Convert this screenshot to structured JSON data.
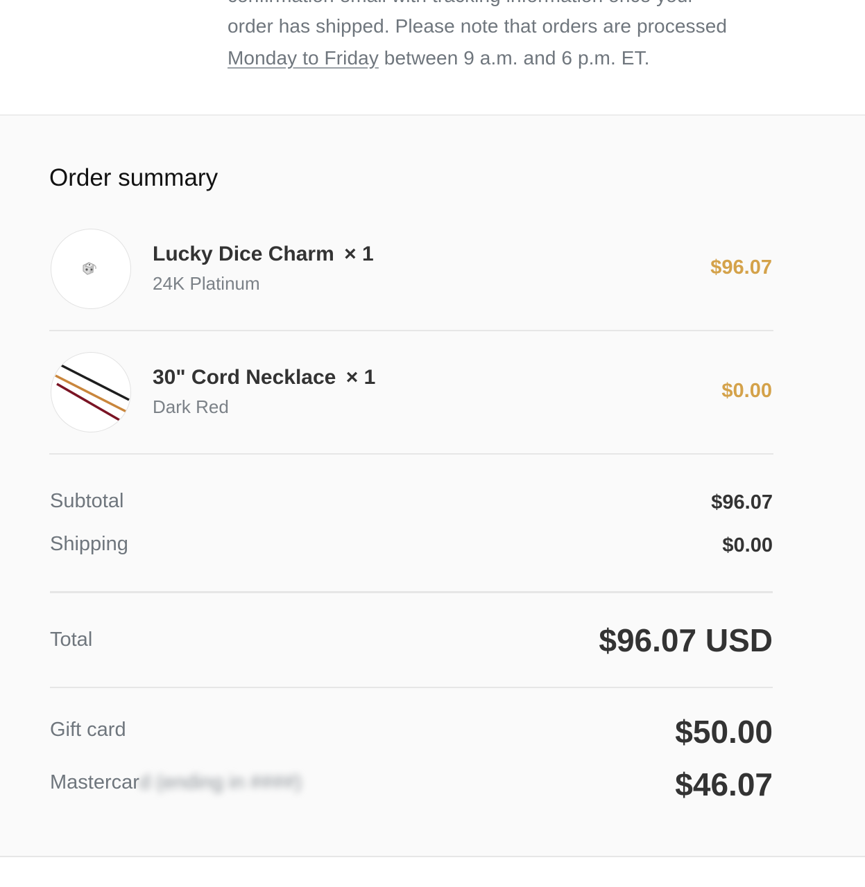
{
  "shipping_note": {
    "line0": "confirmation email with tracking information once your",
    "line1": "order has shipped. Please note that orders are processed",
    "line2_link": "Monday to Friday",
    "line2_rest": " between 9 a.m. and 6 p.m. ET."
  },
  "order_summary": {
    "title": "Order summary",
    "items": [
      {
        "name": "Lucky Dice Charm",
        "qty_label": "× 1",
        "variant": "24K Platinum",
        "price": "$96.07",
        "image_icon": "dice-charm-image"
      },
      {
        "name": "30\" Cord Necklace",
        "qty_label": "× 1",
        "variant": "Dark Red",
        "price": "$0.00",
        "image_icon": "cord-necklace-image"
      }
    ],
    "subtotal_label": "Subtotal",
    "subtotal_value": "$96.07",
    "shipping_label": "Shipping",
    "shipping_value": "$0.00",
    "total_label": "Total",
    "total_value": "$96.07 USD",
    "payments": [
      {
        "label": "Gift card",
        "value": "$50.00"
      },
      {
        "label": "Mastercar",
        "label_obscured": "d (ending in ####)",
        "value": "$46.07"
      }
    ]
  },
  "colors": {
    "price_accent": "#d4a24a",
    "muted_text": "#6f767d",
    "strong_text": "#333333",
    "summary_bg": "#fafafa"
  }
}
